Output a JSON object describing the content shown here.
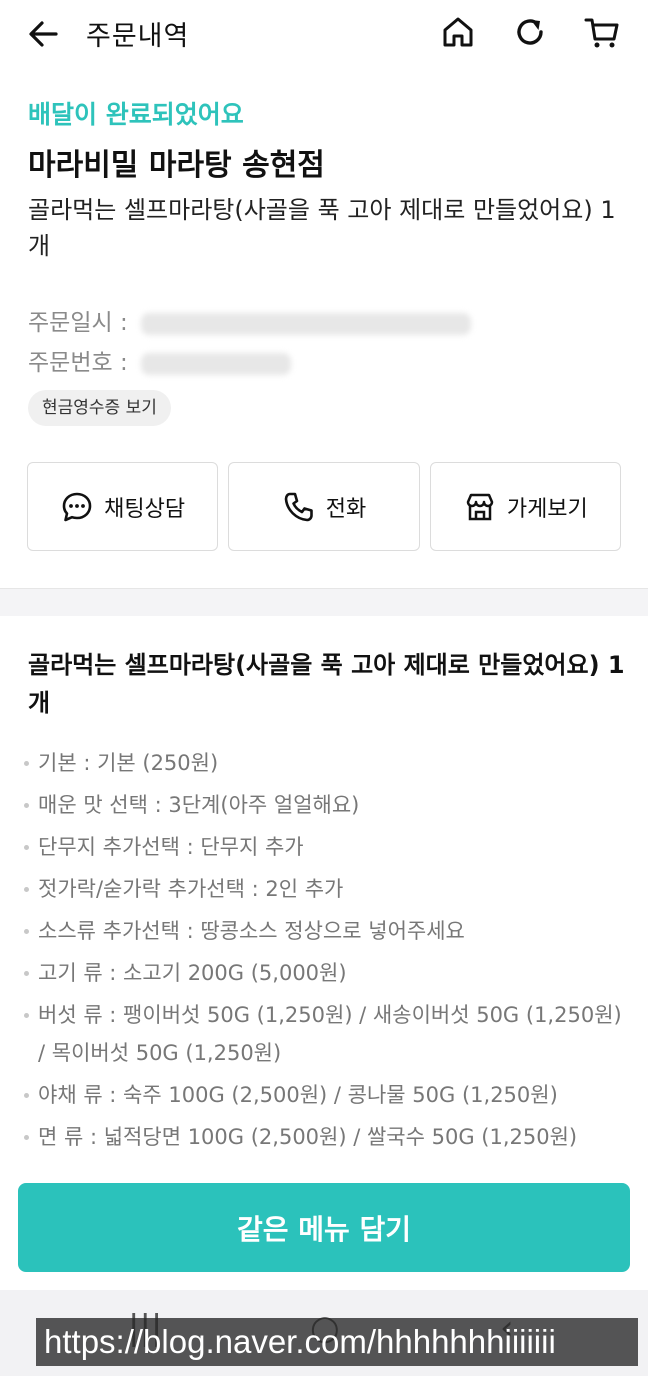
{
  "header": {
    "title": "주문내역",
    "icons": [
      "back-arrow-icon",
      "home-icon",
      "refresh-icon",
      "cart-icon"
    ]
  },
  "order": {
    "status": "배달이 완료되었어요",
    "store_name": "마라비밀 마라탕 송현점",
    "summary": "골라먹는 셀프마라탕(사골을 푹 고아 제대로 만들었어요) 1개",
    "order_date_label": "주문일시 :",
    "order_number_label": "주문번호 :",
    "receipt_button": "현금영수증 보기"
  },
  "actions": {
    "chat": "채팅상담",
    "call": "전화",
    "store": "가게보기"
  },
  "menu": {
    "title": "골라먹는 셀프마라탕(사골을 푹 고아 제대로 만들었어요) 1개",
    "options": [
      "기본 : 기본 (250원)",
      "매운 맛 선택 : 3단계(아주 얼얼해요)",
      "단무지 추가선택 : 단무지 추가",
      "젓가락/숟가락 추가선택 : 2인 추가",
      "소스류 추가선택 : 땅콩소스 정상으로 넣어주세요",
      "고기 류 : 소고기 200G (5,000원)",
      "버섯 류 : 팽이버섯 50G (1,250원) / 새송이버섯 50G (1,250원) / 목이버섯 50G (1,250원)",
      "야채 류 : 숙주 100G (2,500원) / 콩나물 50G (1,250원)",
      "면 류 : 넓적당면 100G (2,500원) / 쌀국수 50G (1,250원)"
    ]
  },
  "cta": {
    "label": "같은 메뉴 담기"
  },
  "watermark": "https://blog.naver.com/hhhhhhhiiiiiii",
  "colors": {
    "accent": "#2bc2bb",
    "status": "#2ec3bb"
  }
}
